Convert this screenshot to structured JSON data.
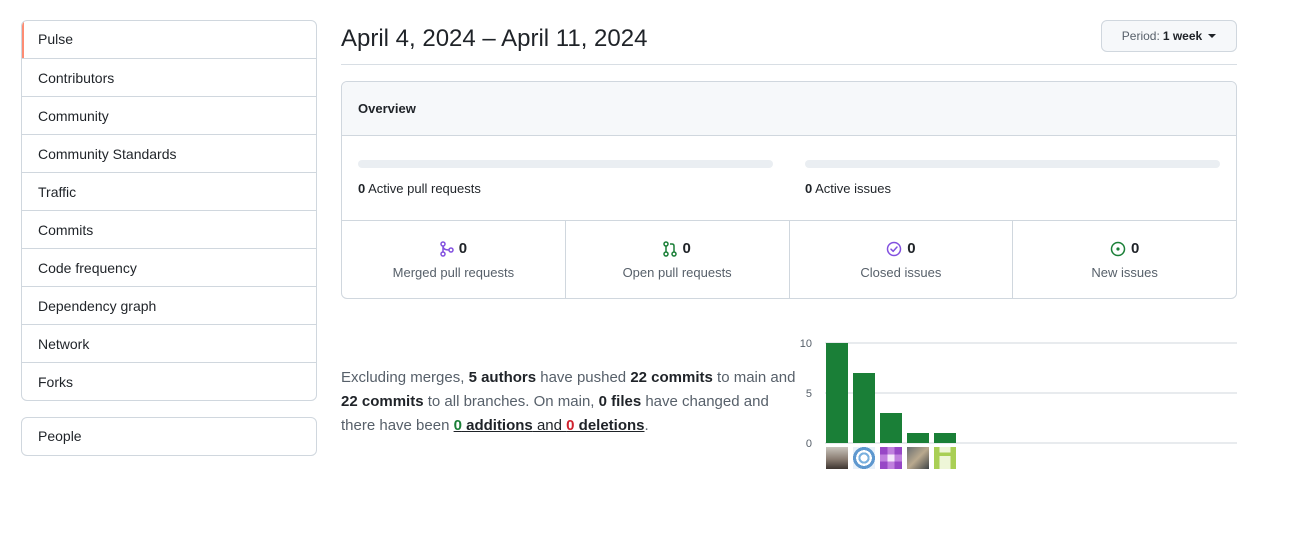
{
  "sidebar": {
    "items": [
      {
        "label": "Pulse",
        "selected": true
      },
      {
        "label": "Contributors"
      },
      {
        "label": "Community"
      },
      {
        "label": "Community Standards"
      },
      {
        "label": "Traffic"
      },
      {
        "label": "Commits"
      },
      {
        "label": "Code frequency"
      },
      {
        "label": "Dependency graph"
      },
      {
        "label": "Network"
      },
      {
        "label": "Forks"
      }
    ],
    "secondary": [
      {
        "label": "People"
      }
    ]
  },
  "header": {
    "title": "April 4, 2024 – April 11, 2024",
    "period_label": "Period:",
    "period_value": "1 week"
  },
  "overview": {
    "title": "Overview",
    "active_pull_requests": {
      "count": "0",
      "label": "Active pull requests",
      "progress": 0
    },
    "active_issues": {
      "count": "0",
      "label": "Active issues",
      "progress": 0
    },
    "stats": [
      {
        "count": "0",
        "label": "Merged pull requests",
        "icon": "git-merge-icon",
        "color": "#8250df"
      },
      {
        "count": "0",
        "label": "Open pull requests",
        "icon": "git-pull-request-icon",
        "color": "#1a7f37"
      },
      {
        "count": "0",
        "label": "Closed issues",
        "icon": "issue-closed-icon",
        "color": "#8250df"
      },
      {
        "count": "0",
        "label": "New issues",
        "icon": "issue-opened-icon",
        "color": "#1a7f37"
      }
    ]
  },
  "summary": {
    "t1": "Excluding merges, ",
    "authors": "5 authors",
    "t2": " have pushed ",
    "commits_main": "22 commits",
    "t3": " to main and ",
    "commits_all": "22 commits",
    "t4": " to all branches. On main, ",
    "files": "0 files",
    "t5": " have changed and there have been ",
    "additions_count": "0",
    "additions_word": " additions",
    "and": " and ",
    "deletions_count": "0",
    "deletions_word": " deletions",
    "end": "."
  },
  "chart_data": {
    "type": "bar",
    "categories": [
      "author 1",
      "author 2",
      "author 3",
      "author 4",
      "author 5"
    ],
    "values": [
      10,
      7,
      3,
      1,
      1
    ],
    "yticks": [
      0,
      5,
      10
    ],
    "ylim": [
      0,
      10
    ],
    "bar_color": "#1a7f37",
    "grid": true
  },
  "colors": {
    "accent_selected": "#fd8c73",
    "additions": "#1a7f37",
    "deletions": "#cf222e"
  }
}
